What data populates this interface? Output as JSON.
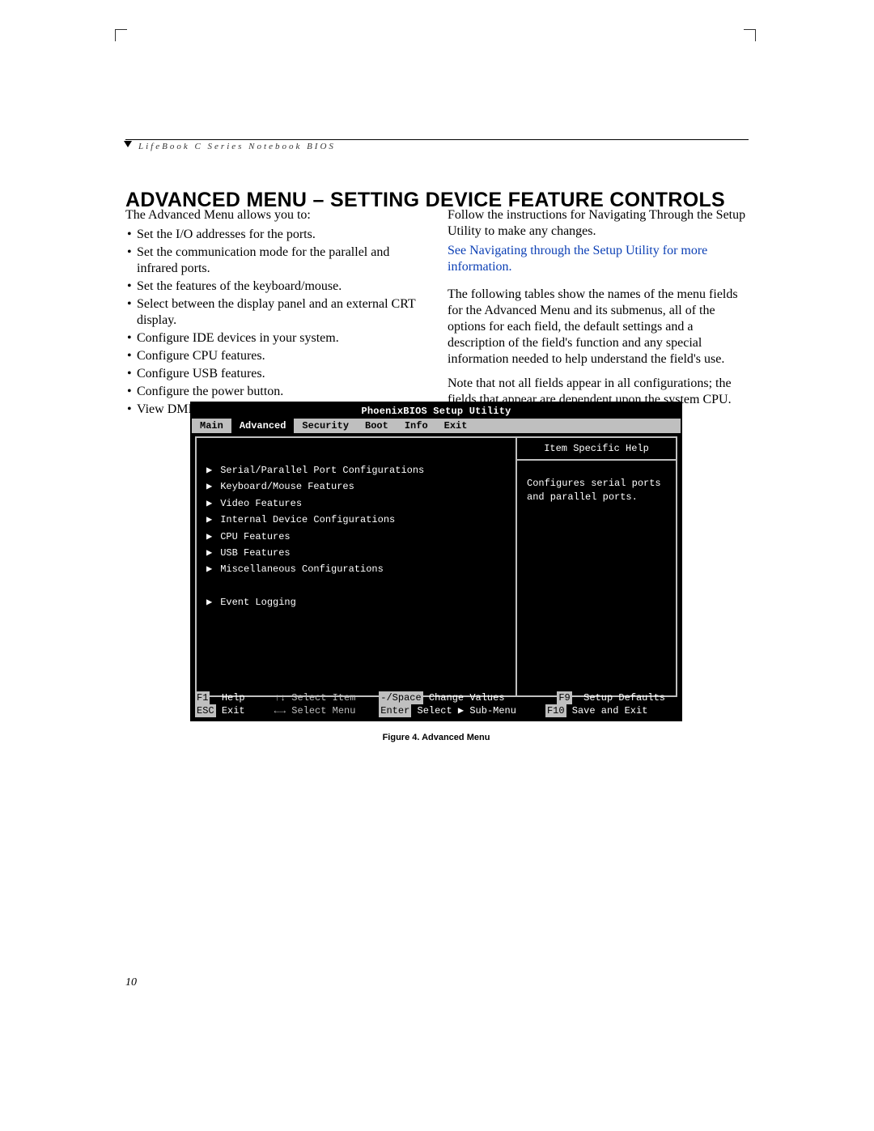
{
  "header": {
    "running_head": "LifeBook C Series Notebook BIOS"
  },
  "heading": "ADVANCED MENU – SETTING DEVICE FEATURE CONTROLS",
  "left_column": {
    "intro": "The Advanced Menu allows you to:",
    "bullets": [
      "Set the I/O addresses for the ports.",
      "Set the communication mode for the parallel and infrared ports.",
      "Set the features of the keyboard/mouse.",
      "Select between the display panel and an external CRT display.",
      "Configure IDE devices in your system.",
      "Configure CPU features.",
      "Configure USB features.",
      "Configure the power button.",
      "View DMI Event Logging"
    ]
  },
  "right_column": {
    "p1": "Follow the instructions for Navigating Through the Setup Utility to make any changes.",
    "link": "See Navigating through the Setup Utility for more information.",
    "p2": "The following tables show the names of the menu fields for the Advanced Menu and its submenus, all of the options for each field, the default settings and a description of the field's function and any special information needed to help understand the field's use.",
    "p3": "Note that not all fields appear in all configurations; the fields that appear are dependent upon the system CPU."
  },
  "bios": {
    "title": "PhoenixBIOS Setup Utility",
    "tabs": [
      "Main",
      "Advanced",
      "Security",
      "Boot",
      "Info",
      "Exit"
    ],
    "selected_tab": "Advanced",
    "menu_items": [
      "Serial/Parallel Port Configurations",
      "Keyboard/Mouse Features",
      "Video Features",
      "Internal Device Configurations",
      "CPU Features",
      "USB Features",
      "Miscellaneous Configurations",
      "",
      "Event Logging"
    ],
    "help_title": "Item Specific Help",
    "help_body": "Configures serial ports and parallel ports.",
    "footer": {
      "row1": {
        "k1": "F1",
        "t1": "Help",
        "arr1": "↑↓",
        "t2": "Select Item",
        "k2": "-/Space",
        "t3": "Change Values",
        "k3": "F9",
        "t4": "Setup Defaults"
      },
      "row2": {
        "k1": "ESC",
        "t1": "Exit",
        "arr1": "←→",
        "t2": "Select Menu",
        "k2": "Enter",
        "t3": "Select ▶ Sub-Menu",
        "k3": "F10",
        "t4": "Save and Exit"
      }
    }
  },
  "figure_caption": "Figure 4.  Advanced Menu",
  "page_number": "10"
}
